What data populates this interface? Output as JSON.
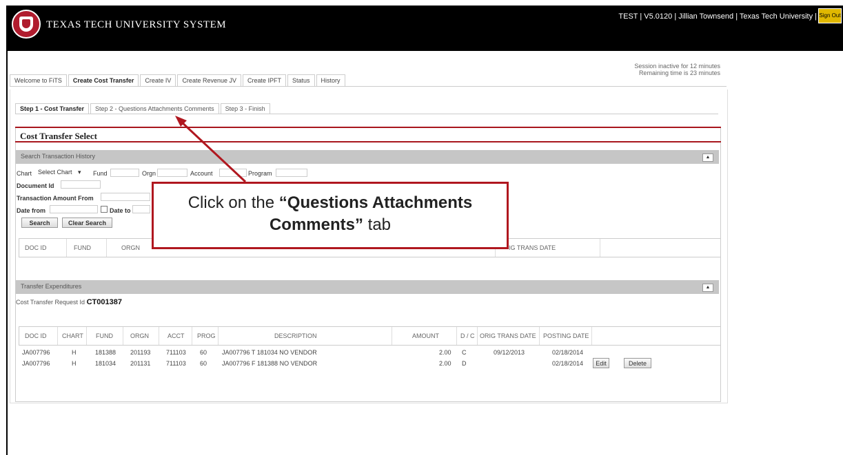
{
  "header": {
    "system_name": "TEXAS TECH UNIVERSITY SYSTEM",
    "user_info": "TEST | V5.0120 | Jillian Townsend | Texas Tech University |",
    "signout_label": "Sign Out"
  },
  "session": {
    "line1": "Session inactive for 12 minutes",
    "line2": "Remaining time is 23 minutes"
  },
  "main_tabs": [
    {
      "label": "Welcome to FiTS"
    },
    {
      "label": "Create Cost Transfer"
    },
    {
      "label": "Create IV"
    },
    {
      "label": "Create Revenue JV"
    },
    {
      "label": "Create IPFT"
    },
    {
      "label": "Status"
    },
    {
      "label": "History"
    }
  ],
  "step_tabs": [
    {
      "label": "Step 1 - Cost Transfer"
    },
    {
      "label": "Step 2 - Questions Attachments Comments"
    },
    {
      "label": "Step 3 - Finish"
    }
  ],
  "panel_title": "Cost Transfer Select",
  "search": {
    "section_title": "Search Transaction History",
    "chart_label": "Chart",
    "chart_value": "Select Chart",
    "fund_label": "Fund",
    "orgn_label": "Orgn",
    "account_label": "Account",
    "program_label": "Program",
    "document_id_label": "Document Id",
    "amount_from_label": "Transaction Amount From",
    "date_from_label": "Date from",
    "date_to_label": "Date to",
    "search_button": "Search",
    "clear_button": "Clear Search",
    "headers": [
      "DOC ID",
      "FUND",
      "ORGN",
      "IG TRANS DATE"
    ]
  },
  "expenditures": {
    "section_title": "Transfer Expenditures",
    "request_label": "Cost Transfer Request Id",
    "request_id": "CT001387",
    "headers": [
      "DOC ID",
      "CHART",
      "FUND",
      "ORGN",
      "ACCT",
      "PROG",
      "DESCRIPTION",
      "AMOUNT",
      "D / C",
      "ORIG TRANS DATE",
      "POSTING DATE"
    ],
    "rows": [
      {
        "doc_id": "JA007796",
        "chart": "H",
        "fund": "181388",
        "orgn": "201193",
        "acct": "711103",
        "prog": "60",
        "description": "JA007796 T 181034 NO VENDOR",
        "amount": "2.00",
        "dc": "C",
        "orig_date": "09/12/2013",
        "posting_date": "02/18/2014"
      },
      {
        "doc_id": "JA007796",
        "chart": "H",
        "fund": "181034",
        "orgn": "201131",
        "acct": "711103",
        "prog": "60",
        "description": "JA007796 F 181388 NO VENDOR",
        "amount": "2.00",
        "dc": "D",
        "orig_date": "",
        "posting_date": "02/18/2014"
      }
    ],
    "edit_label": "Edit",
    "delete_label": "Delete"
  },
  "callout": {
    "prefix": "Click on the",
    "emphasis": "“Questions Attachments Comments”",
    "suffix": "tab"
  },
  "colors": {
    "brand_red": "#a8151c",
    "header_bg": "#000000",
    "section_bg": "#c6c6c6"
  }
}
